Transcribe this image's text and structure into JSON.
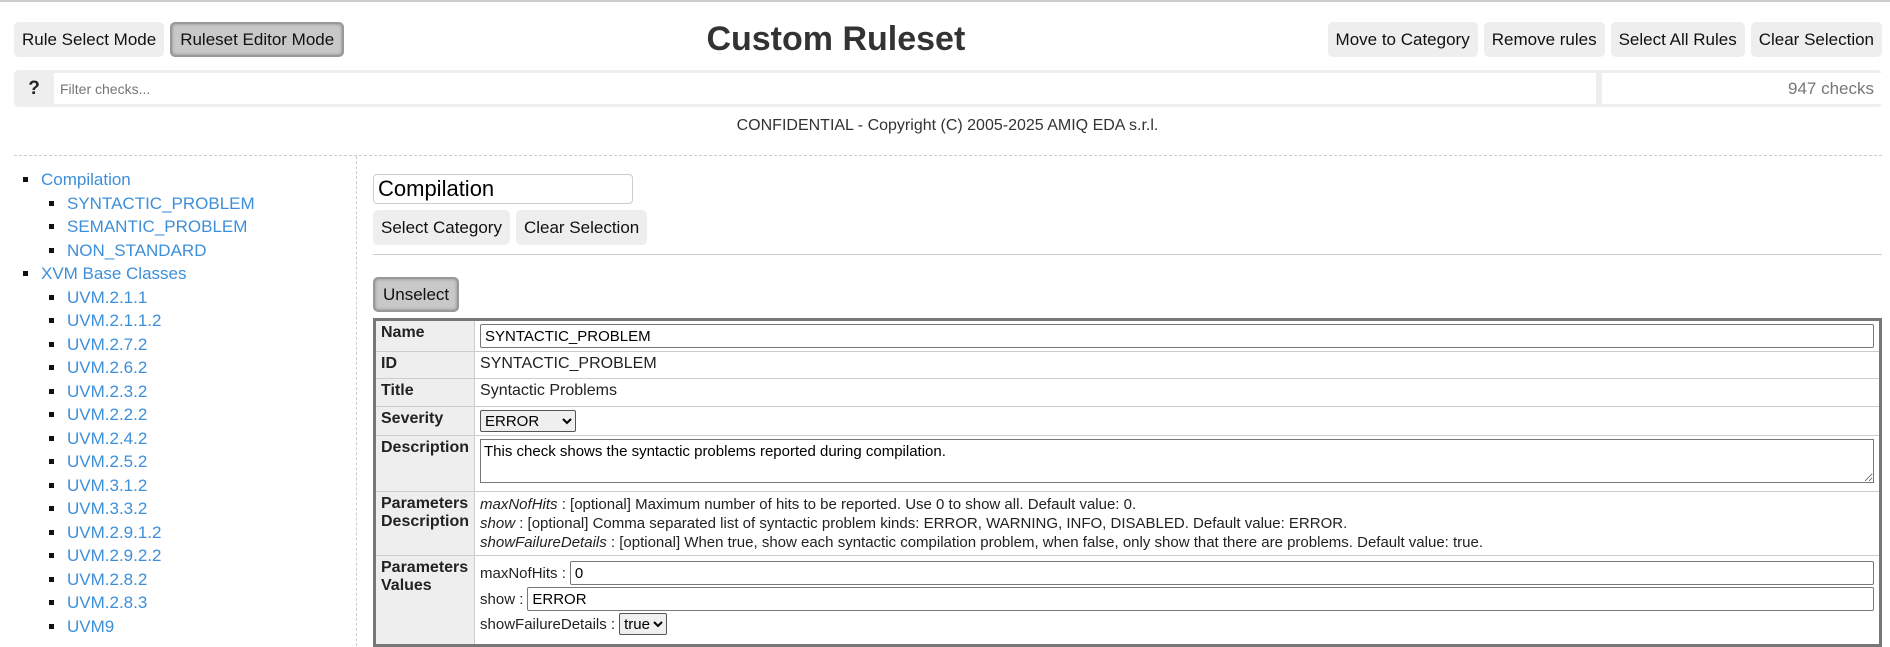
{
  "header": {
    "title": "Custom Ruleset",
    "mode_buttons": [
      "Rule Select Mode",
      "Ruleset Editor Mode"
    ],
    "active_mode": "Ruleset Editor Mode",
    "actions": [
      "Move to Category",
      "Remove rules",
      "Select All Rules",
      "Clear Selection"
    ]
  },
  "filter": {
    "help": "?",
    "placeholder": "Filter checks...",
    "value": "",
    "count": "947 checks"
  },
  "copyright": "CONFIDENTIAL - Copyright (C) 2005-2025 AMIQ EDA s.r.l.",
  "sidebar": {
    "categories": [
      {
        "label": "Compilation",
        "items": [
          "SYNTACTIC_PROBLEM",
          "SEMANTIC_PROBLEM",
          "NON_STANDARD"
        ]
      },
      {
        "label": "XVM Base Classes",
        "items": [
          "UVM.2.1.1",
          "UVM.2.1.1.2",
          "UVM.2.7.2",
          "UVM.2.6.2",
          "UVM.2.3.2",
          "UVM.2.2.2",
          "UVM.2.4.2",
          "UVM.2.5.2",
          "UVM.3.1.2",
          "UVM.3.3.2",
          "UVM.2.9.1.2",
          "UVM.2.9.2.2",
          "UVM.2.8.2",
          "UVM.2.8.3",
          "UVM9"
        ]
      }
    ]
  },
  "main": {
    "category_name": "Compilation",
    "select_category": "Select Category",
    "clear_selection": "Clear Selection",
    "unselect": "Unselect",
    "rule": {
      "labels": {
        "name": "Name",
        "id": "ID",
        "title": "Title",
        "severity": "Severity",
        "description": "Description",
        "params_desc": "Parameters Description",
        "params_values": "Parameters Values"
      },
      "name": "SYNTACTIC_PROBLEM",
      "id": "SYNTACTIC_PROBLEM",
      "title": "Syntactic Problems",
      "severity": "ERROR",
      "description": "This check shows the syntactic problems reported during compilation.",
      "param_descriptions": [
        {
          "name": "maxNofHits",
          "text": " : [optional] Maximum number of hits to be reported. Use 0 to show all. Default value: 0."
        },
        {
          "name": "show",
          "text": " : [optional] Comma separated list of syntactic problem kinds: ERROR, WARNING, INFO, DISABLED. Default value: ERROR."
        },
        {
          "name": "showFailureDetails",
          "text": " : [optional] When true, show each syntactic compilation problem, when false, only show that there are problems. Default value: true."
        }
      ],
      "param_values": {
        "maxNofHits_label": "maxNofHits :",
        "maxNofHits": "0",
        "show_label": "show :",
        "show": "ERROR",
        "sfd_label": "showFailureDetails :",
        "sfd": "true"
      }
    }
  }
}
